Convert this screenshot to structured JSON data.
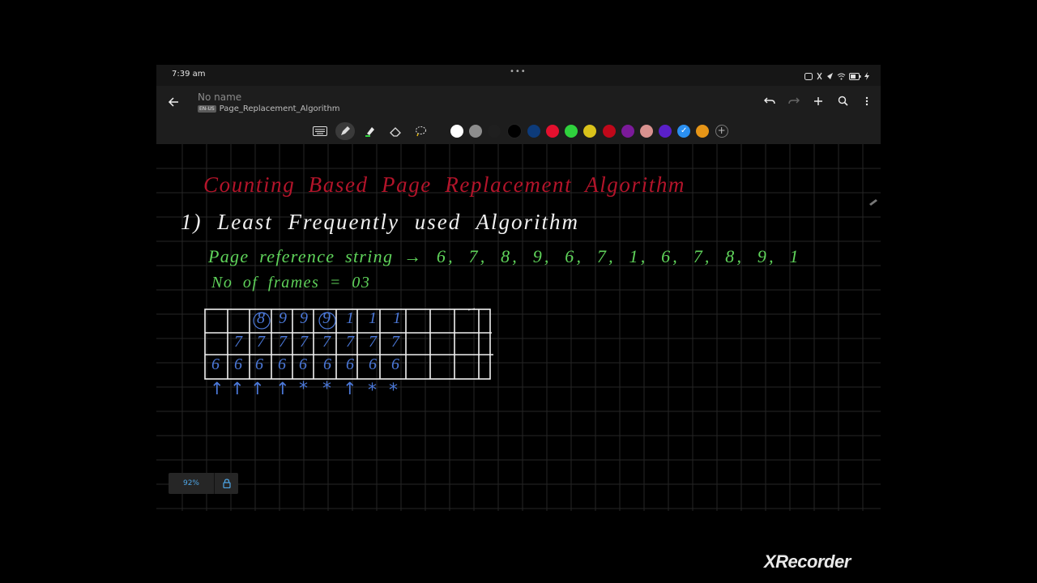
{
  "status": {
    "time": "7:39 am",
    "dots": "•••"
  },
  "doc": {
    "title": "No name",
    "lang_tag": "EN-US",
    "subtitle": "Page_Replacement_Algorithm"
  },
  "icons": {
    "back": "arrow-left-icon",
    "undo": "undo-icon",
    "redo": "redo-icon",
    "add": "plus-icon",
    "search": "search-icon",
    "more": "more-vertical-icon",
    "tools": [
      "keyboard-icon",
      "pen-icon",
      "highlighter-icon",
      "eraser-icon",
      "lasso-icon"
    ]
  },
  "palette": [
    "#ffffff",
    "#8c8c8c",
    "#1f1f1f",
    "#000000",
    "#0d3b7a",
    "#e4102e",
    "#2fd23d",
    "#d9c21a",
    "#c0081a",
    "#7b1a9a",
    "#d9928f",
    "#5a1fc9",
    "#2a8ff0",
    "#e69517"
  ],
  "palette_selected": 12,
  "notes": {
    "heading": "Counting Based Page Replacement Algorithm",
    "item": "1) Least Frequently used Algorithm",
    "ref_label": "Page reference string →",
    "ref_string": "6, 7, 8, 9, 6, 7, 1, 6, 7, 8, 9, 1",
    "frames": "No of frames = 03",
    "table": {
      "row1": [
        "",
        "",
        "8",
        "9",
        "9",
        "9",
        "1",
        "1",
        "1",
        "",
        "",
        "",
        ""
      ],
      "row2": [
        "",
        "7",
        "7",
        "7",
        "7",
        "7",
        "7",
        "7",
        "7",
        "",
        "",
        "",
        ""
      ],
      "row3": [
        "6",
        "6",
        "6",
        "6",
        "6",
        "6",
        "6",
        "6",
        "6",
        "",
        "",
        "",
        ""
      ],
      "markers": [
        "↑",
        "↑",
        "↑",
        "↑",
        "*",
        "*",
        "↑",
        "*",
        "*"
      ]
    }
  },
  "colors": {
    "heading": "#b3142a",
    "white_ink": "#f0f0f0",
    "green_ink": "#5fd35a",
    "blue_ink": "#4b78d8"
  },
  "zoom": "92%",
  "watermark": "XRecorder"
}
